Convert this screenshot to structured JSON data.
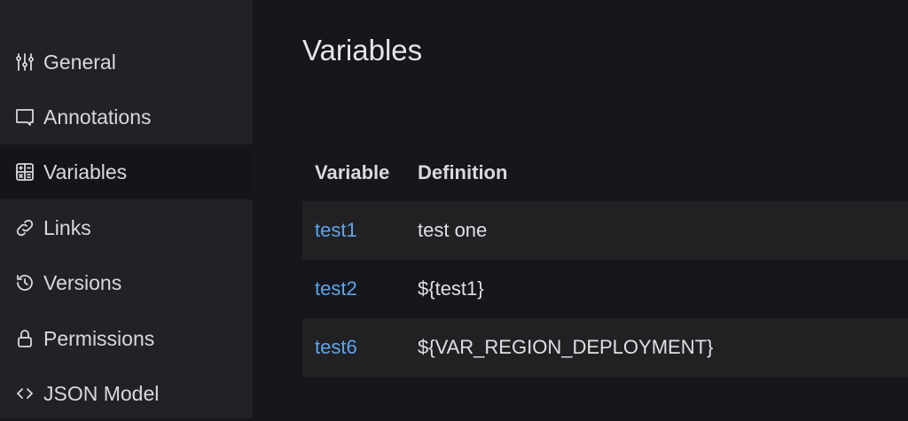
{
  "sidebar": {
    "items": [
      {
        "label": "General",
        "icon": "sliders-icon"
      },
      {
        "label": "Annotations",
        "icon": "comment-icon"
      },
      {
        "label": "Variables",
        "icon": "calculator-icon",
        "active": true
      },
      {
        "label": "Links",
        "icon": "link-icon"
      },
      {
        "label": "Versions",
        "icon": "history-icon"
      },
      {
        "label": "Permissions",
        "icon": "lock-icon"
      },
      {
        "label": "JSON Model",
        "icon": "code-icon"
      }
    ]
  },
  "main": {
    "title": "Variables",
    "table": {
      "headers": [
        "Variable",
        "Definition"
      ],
      "rows": [
        {
          "name": "test1",
          "definition": "test one"
        },
        {
          "name": "test2",
          "definition": "${test1}"
        },
        {
          "name": "test6",
          "definition": "${VAR_REGION_DEPLOYMENT}"
        }
      ]
    }
  },
  "colors": {
    "link": "#5ea5ec",
    "sidebar": "#202226",
    "active": "#141519",
    "background": "#16171c"
  }
}
